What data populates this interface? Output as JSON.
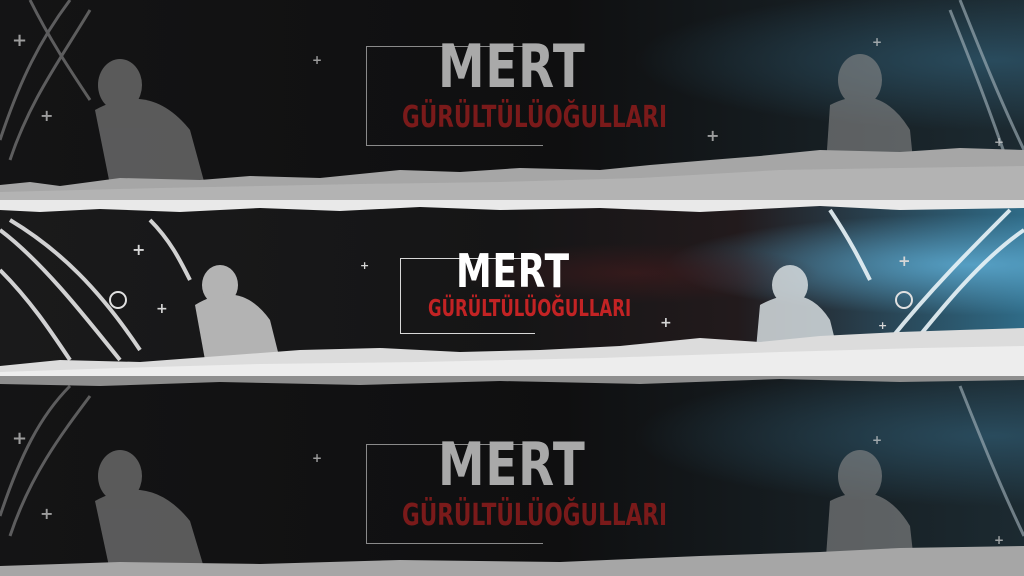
{
  "banner": {
    "first_name": "MERT",
    "surname": "GÜRÜLTÜLÜOĞULLARI",
    "plus_glyph": "+"
  },
  "palette": {
    "background": "#0d0d0e",
    "paper": "#cfcfcf",
    "title_white": "#ffffff",
    "surname_red": "#c22324",
    "accent_blue": "#3c8fb8"
  },
  "icons": {
    "figure": "bust-sculpture-icon",
    "splash": "water-splash-icon",
    "sparkle": "plus-sparkle-icon",
    "paper": "torn-paper-edge"
  }
}
